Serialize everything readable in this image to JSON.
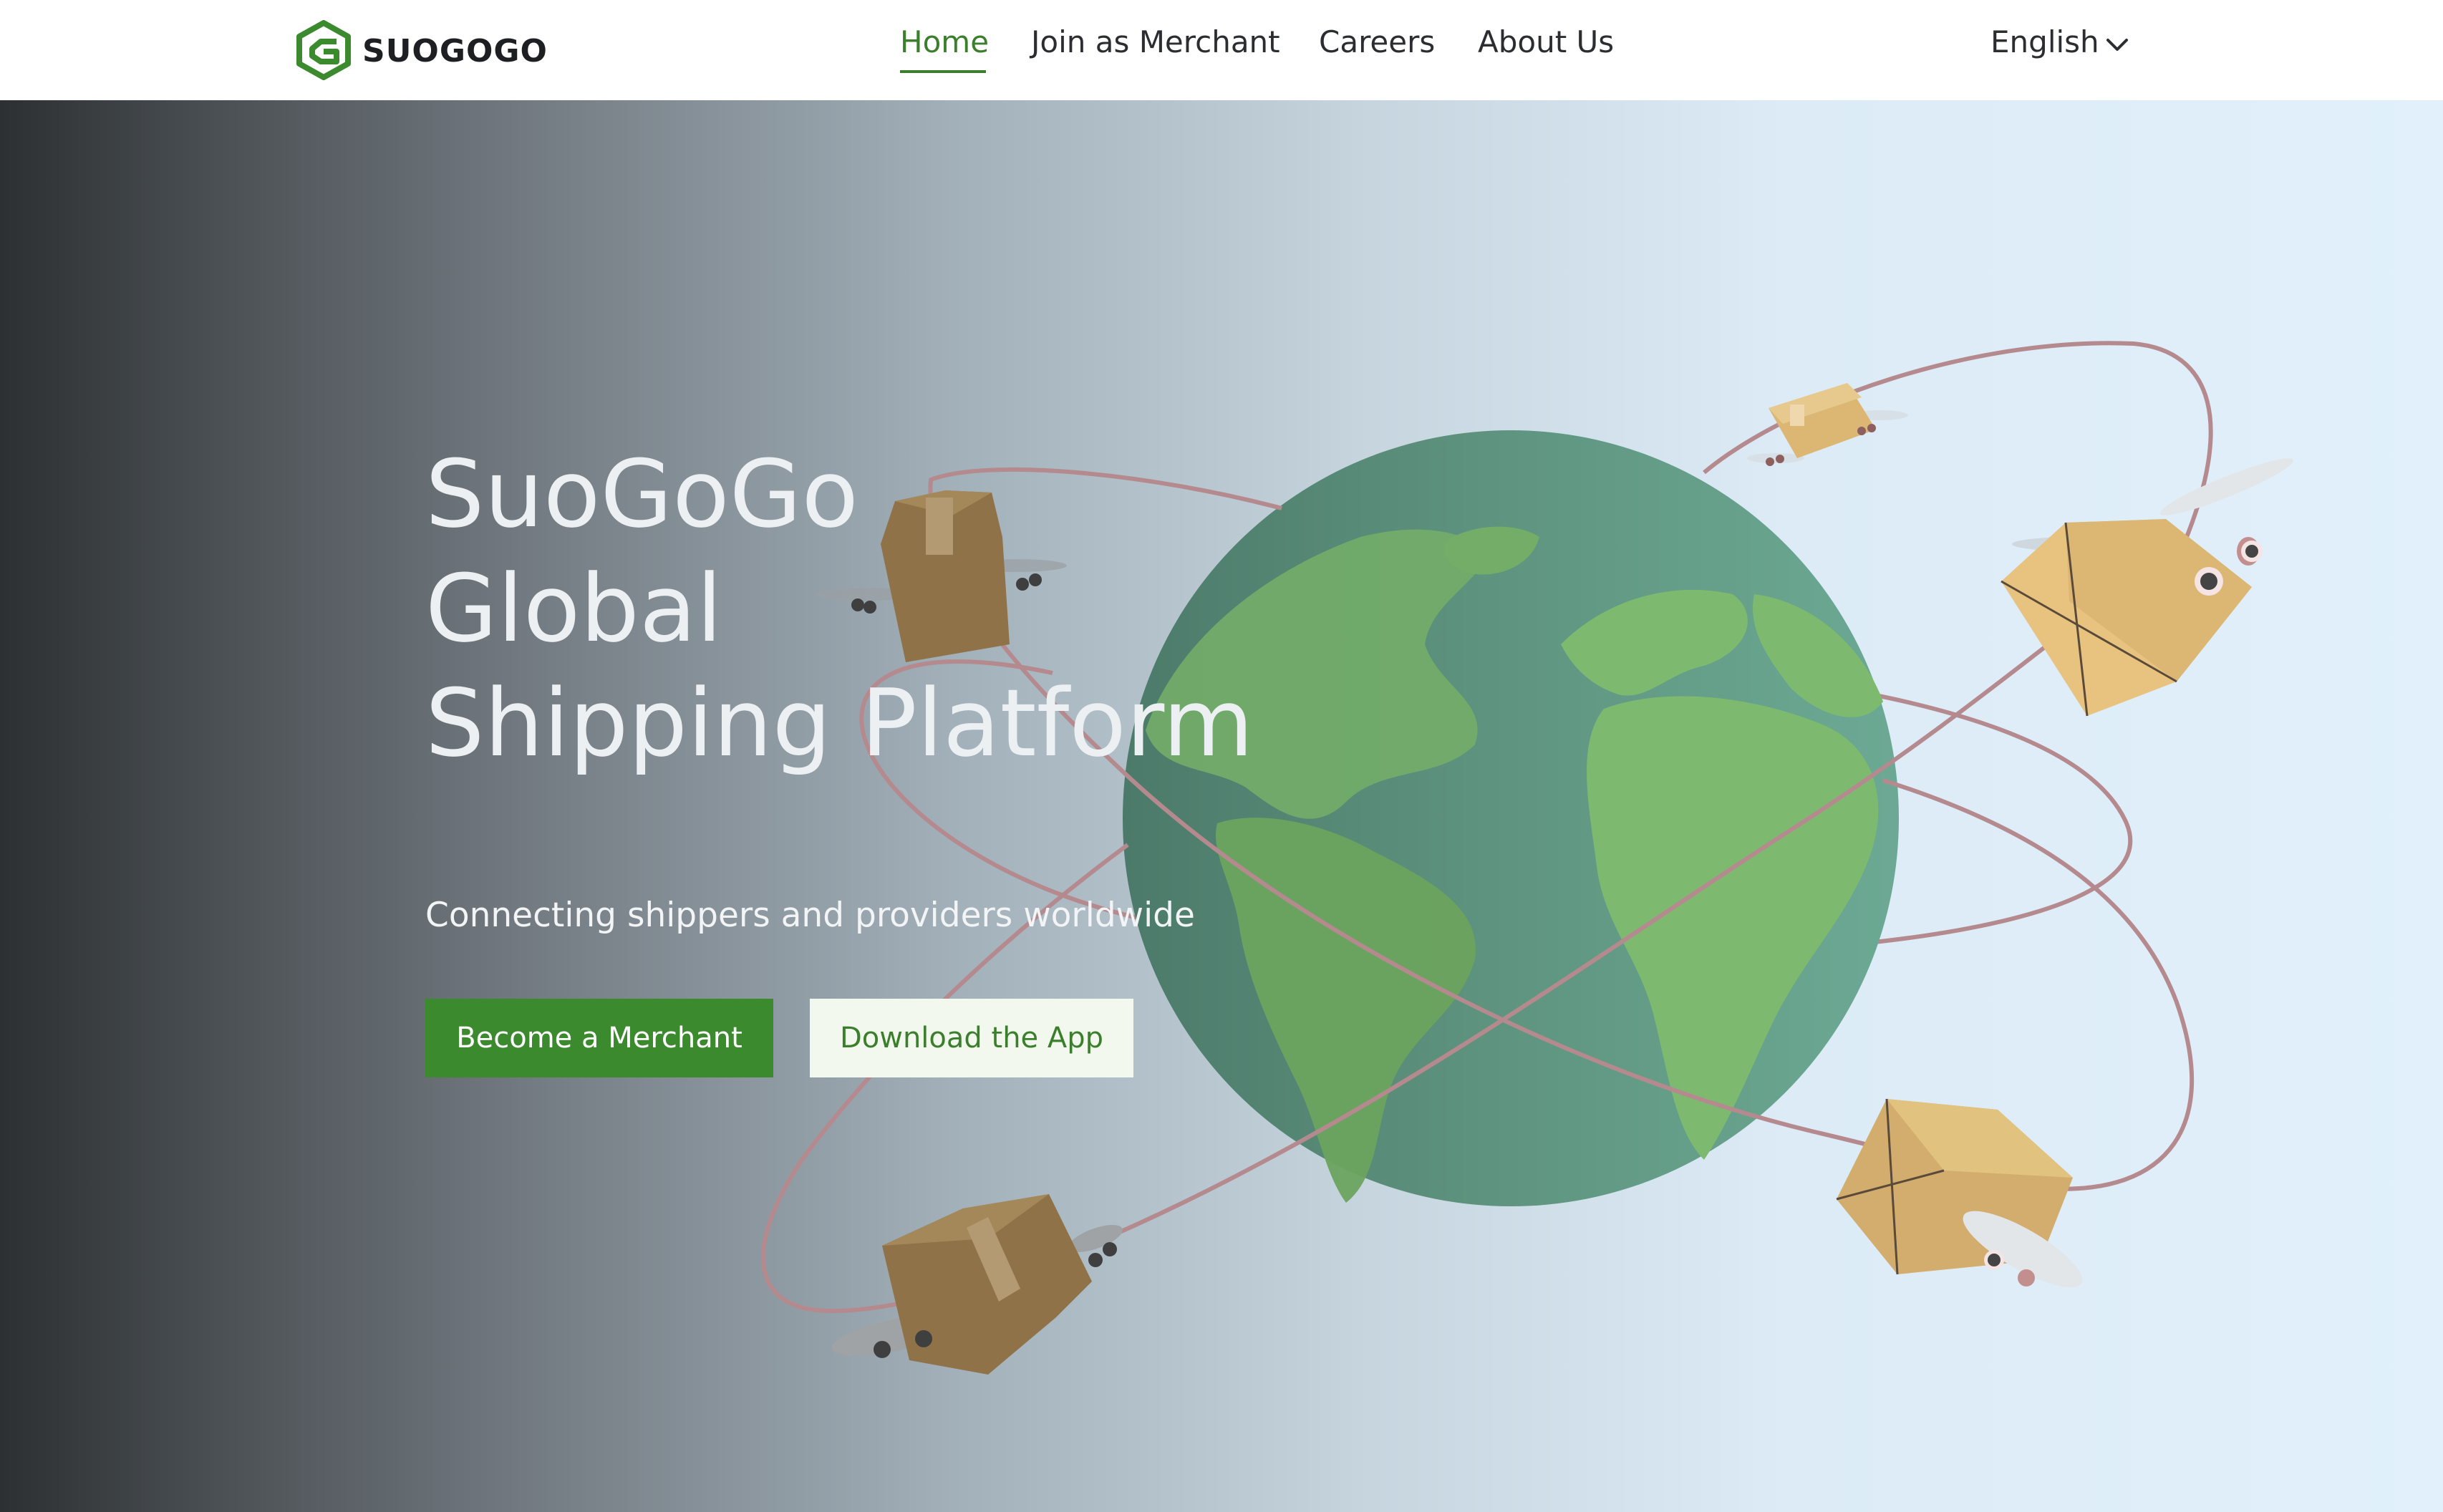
{
  "nav": {
    "brand": "SUOGOGO",
    "links": [
      {
        "label": "Home",
        "active": true
      },
      {
        "label": "Join as Merchant"
      },
      {
        "label": "Careers"
      },
      {
        "label": "About Us"
      }
    ],
    "language": "English",
    "icons": {
      "logo": "hexagon-g-logo-icon",
      "dropdown": "chevron-down-icon"
    }
  },
  "hero": {
    "title_lines": [
      "SuoGoGo",
      "Global",
      "Shipping Platform"
    ],
    "subtitle": "Connecting shippers and providers worldwide",
    "primary_button": "Become a Merchant",
    "secondary_button": "Download the App",
    "illustration": "globe-with-flying-parcels-illustration"
  },
  "colors": {
    "brand_green": "#3b8a2d",
    "active_nav": "#3b7f2c",
    "secondary_button_bg": "#f2f8ee",
    "globe_ocean": "#5e9680",
    "globe_land": "#7db872",
    "orbit": "#b58a8e",
    "box_light": "#e6c07e",
    "box_dark": "#9a7a45"
  }
}
